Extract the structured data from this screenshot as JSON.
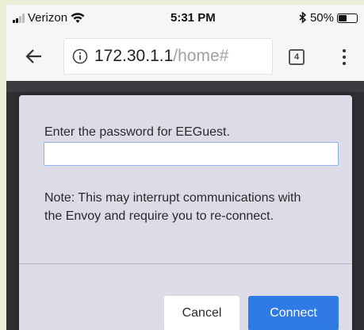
{
  "status_bar": {
    "carrier": "Verizon",
    "time": "5:31 PM",
    "battery_percent": "50%",
    "battery_level": 0.5
  },
  "browser": {
    "url_host": "172.30.1.1",
    "url_path": "/home#",
    "tab_count": "4",
    "icons": {
      "back": "back-arrow-icon",
      "info": "info-icon",
      "menu": "more-vertical-icon"
    }
  },
  "dialog": {
    "prompt": "Enter the password for EEGuest.",
    "password_value": "",
    "note": "Note: This may interrupt communications with the Envoy and require you to re-connect.",
    "cancel_label": "Cancel",
    "connect_label": "Connect"
  },
  "colors": {
    "dialog_bg": "#dcdbe8",
    "accent": "#2f7ae5",
    "page_bg": "#2e2f33"
  }
}
